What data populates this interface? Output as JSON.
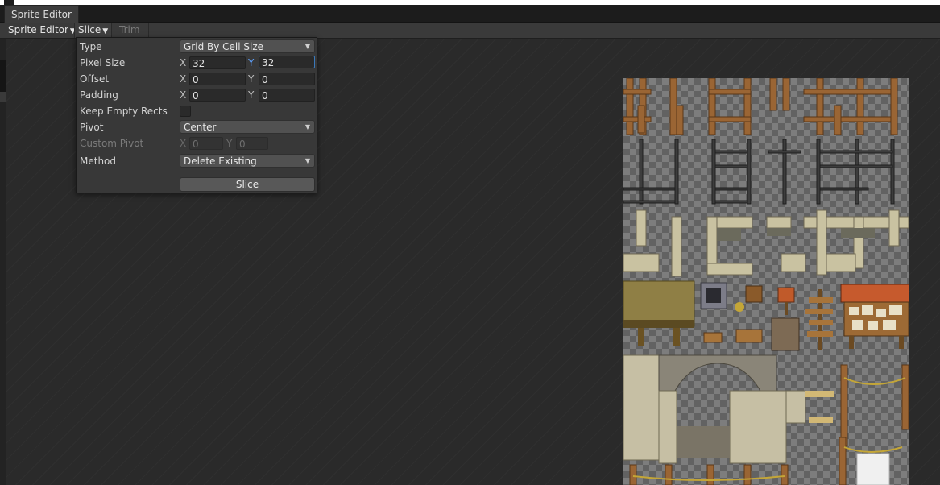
{
  "window": {
    "tab_title": "Sprite Editor"
  },
  "toolbar": {
    "sprite_editor_label": "Sprite Editor",
    "slice_label": "Slice",
    "trim_label": "Trim"
  },
  "slice_panel": {
    "type_label": "Type",
    "type_value": "Grid By Cell Size",
    "pixel_size_label": "Pixel Size",
    "pixel_size_x": "32",
    "pixel_size_y": "32",
    "offset_label": "Offset",
    "offset_x": "0",
    "offset_y": "0",
    "padding_label": "Padding",
    "padding_x": "0",
    "padding_y": "0",
    "keep_empty_label": "Keep Empty Rects",
    "keep_empty_checked": false,
    "pivot_label": "Pivot",
    "pivot_value": "Center",
    "custom_pivot_label": "Custom Pivot",
    "custom_pivot_x": "0",
    "custom_pivot_y": "0",
    "method_label": "Method",
    "method_value": "Delete Existing",
    "slice_button_label": "Slice",
    "axis_x": "X",
    "axis_y": "Y"
  },
  "colors": {
    "panel_bg": "#383838",
    "focus_accent": "#3a79bb",
    "axis_active": "#5ea1ff"
  }
}
